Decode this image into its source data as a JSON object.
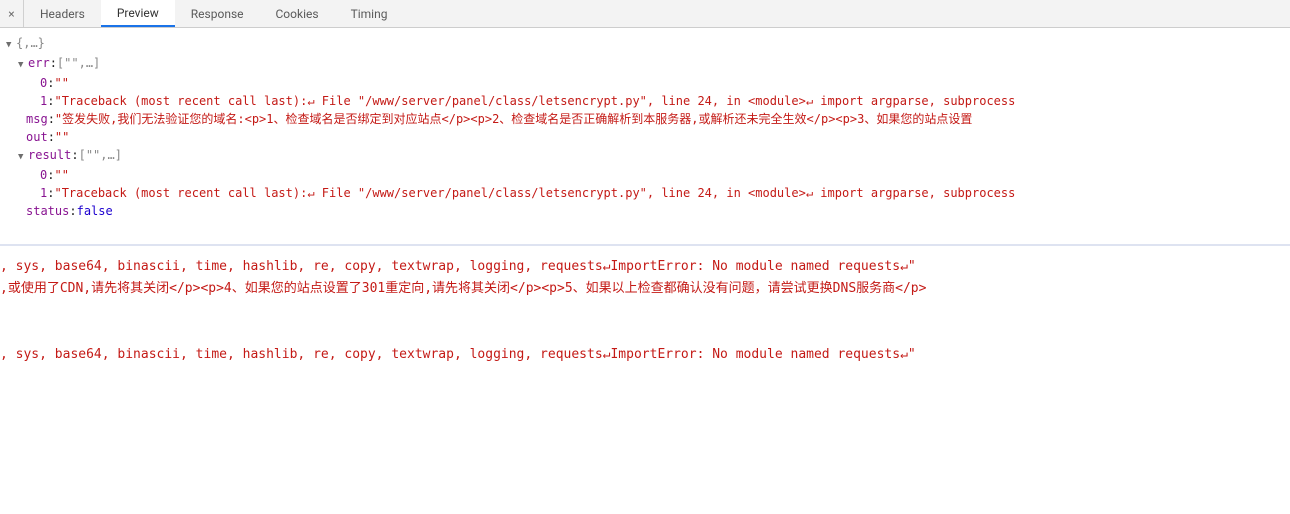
{
  "tabs": {
    "close": "×",
    "headers": "Headers",
    "preview": "Preview",
    "response": "Response",
    "cookies": "Cookies",
    "timing": "Timing"
  },
  "json": {
    "root_summary": "{,…}",
    "err_key": "err",
    "err_summary": "[\"\",…]",
    "err_0_key": "0",
    "err_0_val": "\"\"",
    "err_1_key": "1",
    "err_1_val": "\"Traceback (most recent call last):↵  File \"/www/server/panel/class/letsencrypt.py\", line 24, in <module>↵    import argparse, subprocess",
    "msg_key": "msg",
    "msg_val": "\"签发失败,我们无法验证您的域名:<p>1、检查域名是否绑定到对应站点</p><p>2、检查域名是否正确解析到本服务器,或解析还未完全生效</p><p>3、如果您的站点设置",
    "out_key": "out",
    "out_val": "\"\"",
    "result_key": "result",
    "result_summary": "[\"\",…]",
    "result_0_key": "0",
    "result_0_val": "\"\"",
    "result_1_key": "1",
    "result_1_val": "\"Traceback (most recent call last):↵  File \"/www/server/panel/class/letsencrypt.py\", line 24, in <module>↵    import argparse, subprocess",
    "status_key": "status",
    "status_val": "false"
  },
  "lower": {
    "line1": ", sys, base64, binascii, time, hashlib, re, copy, textwrap, logging, requests↵ImportError: No module named requests↵\"",
    "line2": ",或使用了CDN,请先将其关闭</p><p>4、如果您的站点设置了301重定向,请先将其关闭</p><p>5、如果以上检查都确认没有问题，请尝试更换DNS服务商</p>",
    "line3": ", sys, base64, binascii, time, hashlib, re, copy, textwrap, logging, requests↵ImportError: No module named requests↵\""
  }
}
